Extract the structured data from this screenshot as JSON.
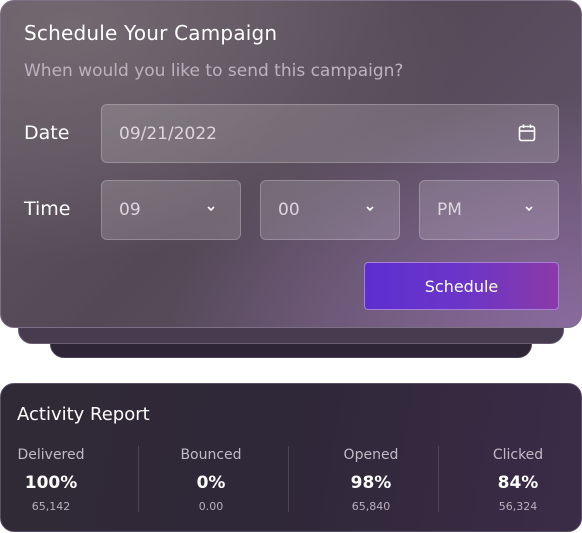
{
  "schedule": {
    "title": "Schedule Your Campaign",
    "subtitle": "When would you like to send this campaign?",
    "date_label": "Date",
    "date_value": "09/21/2022",
    "time_label": "Time",
    "hour_value": "09",
    "minute_value": "00",
    "ampm_value": "PM",
    "button_label": "Schedule",
    "icons": {
      "date": "calendar-icon",
      "select": "chevron-down-icon"
    }
  },
  "activity": {
    "title": "Activity Report",
    "stats": [
      {
        "label": "Delivered",
        "value": "100%",
        "count": "65,142"
      },
      {
        "label": "Bounced",
        "value": "0%",
        "count": "0.00"
      },
      {
        "label": "Opened",
        "value": "98%",
        "count": "65,840"
      },
      {
        "label": "Clicked",
        "value": "84%",
        "count": "56,324"
      }
    ]
  },
  "colors": {
    "button_gradient_start": "#5d2fd0",
    "button_gradient_end": "#8a3aa8",
    "card_background": "#5a4e5e",
    "activity_background": "#302936"
  }
}
